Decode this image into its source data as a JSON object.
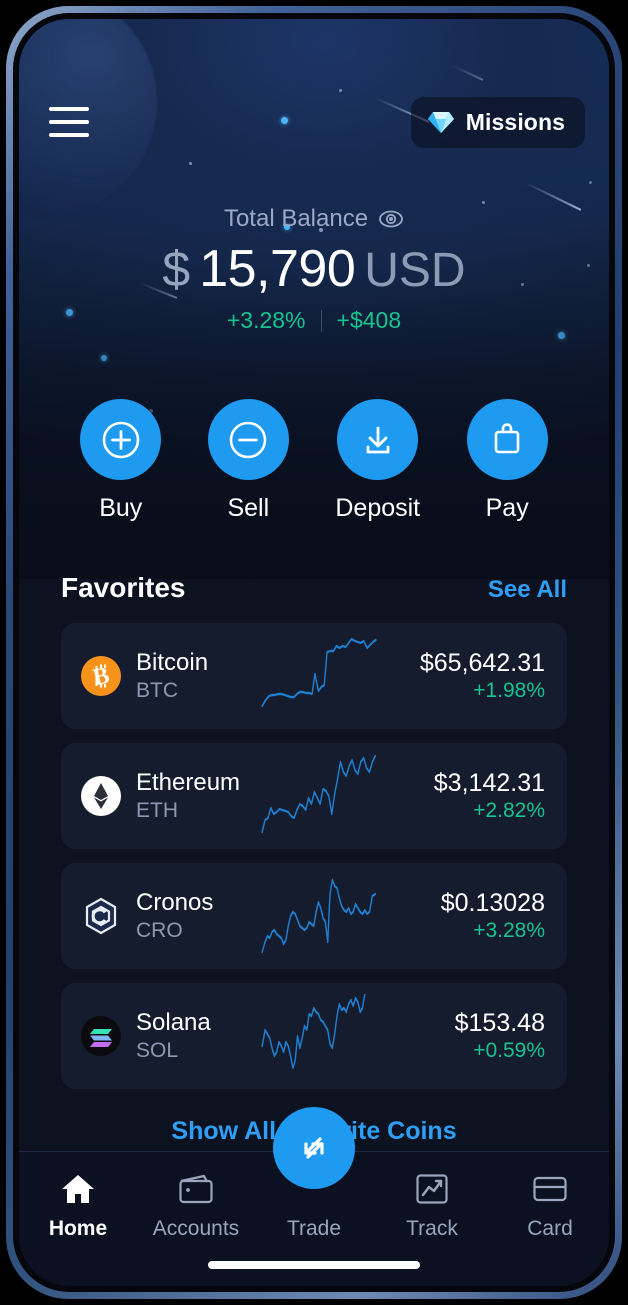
{
  "header": {
    "menu_icon": "hamburger-menu-icon",
    "missions": {
      "label": "Missions",
      "icon": "diamond-gem-icon"
    }
  },
  "balance": {
    "caption": "Total Balance",
    "eye_icon": "eye-visibility-icon",
    "currency_symbol": "$",
    "value": "15,790",
    "currency_code": "USD",
    "change_percent": "+3.28%",
    "change_absolute": "+$408",
    "change_color": "#15c48e"
  },
  "quick_actions": [
    {
      "label": "Buy",
      "icon": "plus-circle-icon"
    },
    {
      "label": "Sell",
      "icon": "minus-circle-icon"
    },
    {
      "label": "Deposit",
      "icon": "download-arrow-icon"
    },
    {
      "label": "Pay",
      "icon": "shopping-bag-icon"
    }
  ],
  "favorites": {
    "title": "Favorites",
    "see_all_label": "See All",
    "show_all_label": "Show All Favorite Coins",
    "coins": [
      {
        "name": "Bitcoin",
        "symbol": "BTC",
        "price": "$65,642.31",
        "change": "+1.98%",
        "logo_icon": "bitcoin-logo-icon",
        "logo_color": "#f7931a"
      },
      {
        "name": "Ethereum",
        "symbol": "ETH",
        "price": "$3,142.31",
        "change": "+2.82%",
        "logo_icon": "ethereum-logo-icon",
        "logo_color": "#ffffff"
      },
      {
        "name": "Cronos",
        "symbol": "CRO",
        "price": "$0.13028",
        "change": "+3.28%",
        "logo_icon": "cronos-logo-icon",
        "logo_color": "#1c2b4a"
      },
      {
        "name": "Solana",
        "symbol": "SOL",
        "price": "$153.48",
        "change": "+0.59%",
        "logo_icon": "solana-logo-icon",
        "logo_color": "#0b0b0f"
      }
    ]
  },
  "bottom_nav": {
    "items": [
      {
        "label": "Home",
        "icon": "home-icon",
        "active": true
      },
      {
        "label": "Accounts",
        "icon": "wallet-icon",
        "active": false
      },
      {
        "label": "Trade",
        "icon": "swap-arrows-icon",
        "active": false
      },
      {
        "label": "Track",
        "icon": "chart-trend-icon",
        "active": false
      },
      {
        "label": "Card",
        "icon": "credit-card-icon",
        "active": false
      }
    ]
  },
  "theme": {
    "accent_blue": "#1e9bf0",
    "link_blue": "#2e9ff5",
    "positive_green": "#15c48e",
    "card_bg": "#151c2e",
    "screen_bg": "#0c1220"
  },
  "chart_data": [
    {
      "type": "line",
      "title": "Bitcoin 24h sparkline",
      "points": [
        5,
        7,
        13,
        15,
        15,
        16,
        16,
        15,
        14,
        13,
        13,
        16,
        18,
        18,
        17,
        17,
        16,
        31,
        20,
        23,
        24,
        52,
        54,
        54,
        62,
        60,
        62,
        61,
        66,
        72,
        70,
        69,
        68,
        70,
        62,
        65,
        69,
        72,
        62,
        64,
        65,
        66,
        65,
        64,
        63,
        63,
        68
      ]
    },
    {
      "type": "line",
      "title": "Ethereum 24h sparkline",
      "points": [
        3,
        14,
        16,
        26,
        20,
        22,
        25,
        24,
        23,
        22,
        18,
        16,
        24,
        30,
        28,
        24,
        36,
        30,
        42,
        36,
        30,
        45,
        43,
        38,
        20,
        40,
        55,
        72,
        62,
        58,
        68,
        74,
        64,
        60,
        72,
        76,
        66,
        62,
        72,
        80,
        76,
        70,
        74,
        78
      ]
    },
    {
      "type": "line",
      "title": "Cronos 24h sparkline",
      "points": [
        4,
        12,
        18,
        16,
        22,
        24,
        20,
        18,
        16,
        10,
        14,
        30,
        42,
        46,
        44,
        38,
        32,
        30,
        28,
        30,
        36,
        34,
        32,
        46,
        58,
        50,
        40,
        36,
        14,
        64,
        80,
        74,
        72,
        60,
        52,
        48,
        46,
        50,
        44,
        46,
        54,
        50,
        46,
        44,
        48,
        44,
        46,
        62
      ]
    },
    {
      "type": "line",
      "title": "Solana 24h sparkline",
      "points": [
        28,
        42,
        38,
        34,
        26,
        18,
        22,
        30,
        26,
        22,
        30,
        26,
        18,
        8,
        14,
        36,
        26,
        34,
        46,
        42,
        56,
        54,
        62,
        58,
        56,
        50,
        48,
        44,
        40,
        28,
        24,
        38,
        54,
        66,
        60,
        62,
        58,
        66,
        70,
        64,
        72,
        68,
        60,
        64,
        78
      ]
    }
  ]
}
